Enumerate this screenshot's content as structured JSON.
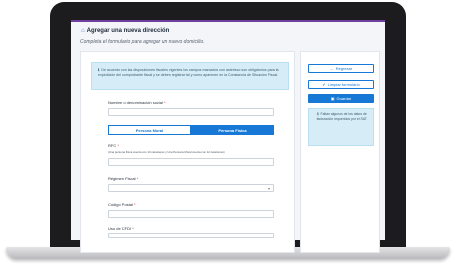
{
  "page": {
    "title": "Agregar una nueva dirección",
    "subtitle": "Completa el formulario para agregar un nuevo domicilio."
  },
  "notice": {
    "text": "De acuerdo con las disposiciones fiscales vigentes los campos marcados con asterisco son obligatorios para la expedición del comprobante fiscal y se deben registrar tal y como aparecen en la Constancia de Situación Fiscal."
  },
  "form": {
    "name_label": "Nombre o denominación social",
    "required_mark": "*",
    "person_type": {
      "options": [
        "Persona Moral",
        "Persona Física"
      ],
      "selected": "Persona Física"
    },
    "rfc_label": "RFC",
    "rfc_hint": "(Una persona física cuenta con 13 caracteres y Una Persona Moral cuenta con 12 caracteres)",
    "regimen_label": "Régimen Fiscal",
    "postal_label": "Código Postal",
    "cfdi_label": "Uso de CFDI"
  },
  "actions": {
    "back": "Regresar",
    "clear": "Limpiar formulario",
    "save": "Guardar"
  },
  "side_info": {
    "text": "Faltan algunos de los datos de facturación requeridos por el SAT."
  },
  "colors": {
    "accent": "#1778d6",
    "notice_bg": "#d6edf8",
    "top_bar": "#6f3fa0"
  }
}
